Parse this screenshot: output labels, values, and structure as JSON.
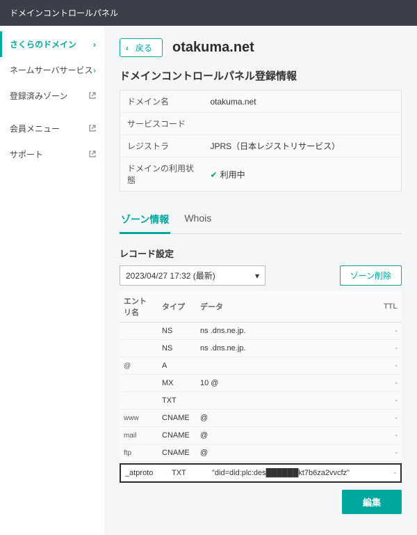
{
  "topbar": {
    "title": "ドメインコントロールパネル"
  },
  "sidebar": {
    "items": [
      {
        "label": "さくらのドメイン",
        "kind": "chev",
        "active": true
      },
      {
        "label": "ネームサーバサービス",
        "kind": "chev",
        "active": false
      },
      {
        "label": "登録済みゾーン",
        "kind": "ext",
        "active": false
      },
      {
        "label": "会員メニュー",
        "kind": "ext",
        "active": false
      },
      {
        "label": "サポート",
        "kind": "ext",
        "active": false
      }
    ]
  },
  "header": {
    "back_label": "戻る",
    "domain": "otakuma.net"
  },
  "info": {
    "title": "ドメインコントロールパネル登録情報",
    "domain_name_k": "ドメイン名",
    "domain_name_v": "otakuma.net",
    "service_code_k": "サービスコード",
    "service_code_v": "",
    "registrar_k": "レジストラ",
    "registrar_v": "JPRS（日本レジストリサービス）",
    "status_k": "ドメインの利用状態",
    "status_v": "利用中"
  },
  "tabs": {
    "zone": "ゾーン情報",
    "whois": "Whois"
  },
  "records_section": {
    "heading": "レコード設定",
    "snapshot": "2023/04/27 17:32 (最新)",
    "zone_delete": "ゾーン削除",
    "columns": {
      "entry": "エントリ名",
      "type": "タイプ",
      "data": "データ",
      "ttl": "TTL"
    },
    "rows": [
      {
        "entry": "",
        "type": "NS",
        "data": "ns  .dns.ne.jp.",
        "ttl": "-"
      },
      {
        "entry": "",
        "type": "NS",
        "data": "ns  .dns.ne.jp.",
        "ttl": "-"
      },
      {
        "entry": "@",
        "type": "A",
        "data": "",
        "ttl": "-"
      },
      {
        "entry": "",
        "type": "MX",
        "data": "10 @",
        "ttl": "-"
      },
      {
        "entry": "",
        "type": "TXT",
        "data": "",
        "ttl": "-"
      },
      {
        "entry": "www",
        "type": "CNAME",
        "data": "@",
        "ttl": "-"
      },
      {
        "entry": "mail",
        "type": "CNAME",
        "data": "@",
        "ttl": "-"
      },
      {
        "entry": "ftp",
        "type": "CNAME",
        "data": "@",
        "ttl": "-"
      }
    ],
    "highlight": {
      "entry": "_atproto",
      "type": "TXT",
      "data": "\"did=did:plc:des██████kt7b6za2vvcfz\"",
      "ttl": "-"
    },
    "edit": "編集"
  }
}
